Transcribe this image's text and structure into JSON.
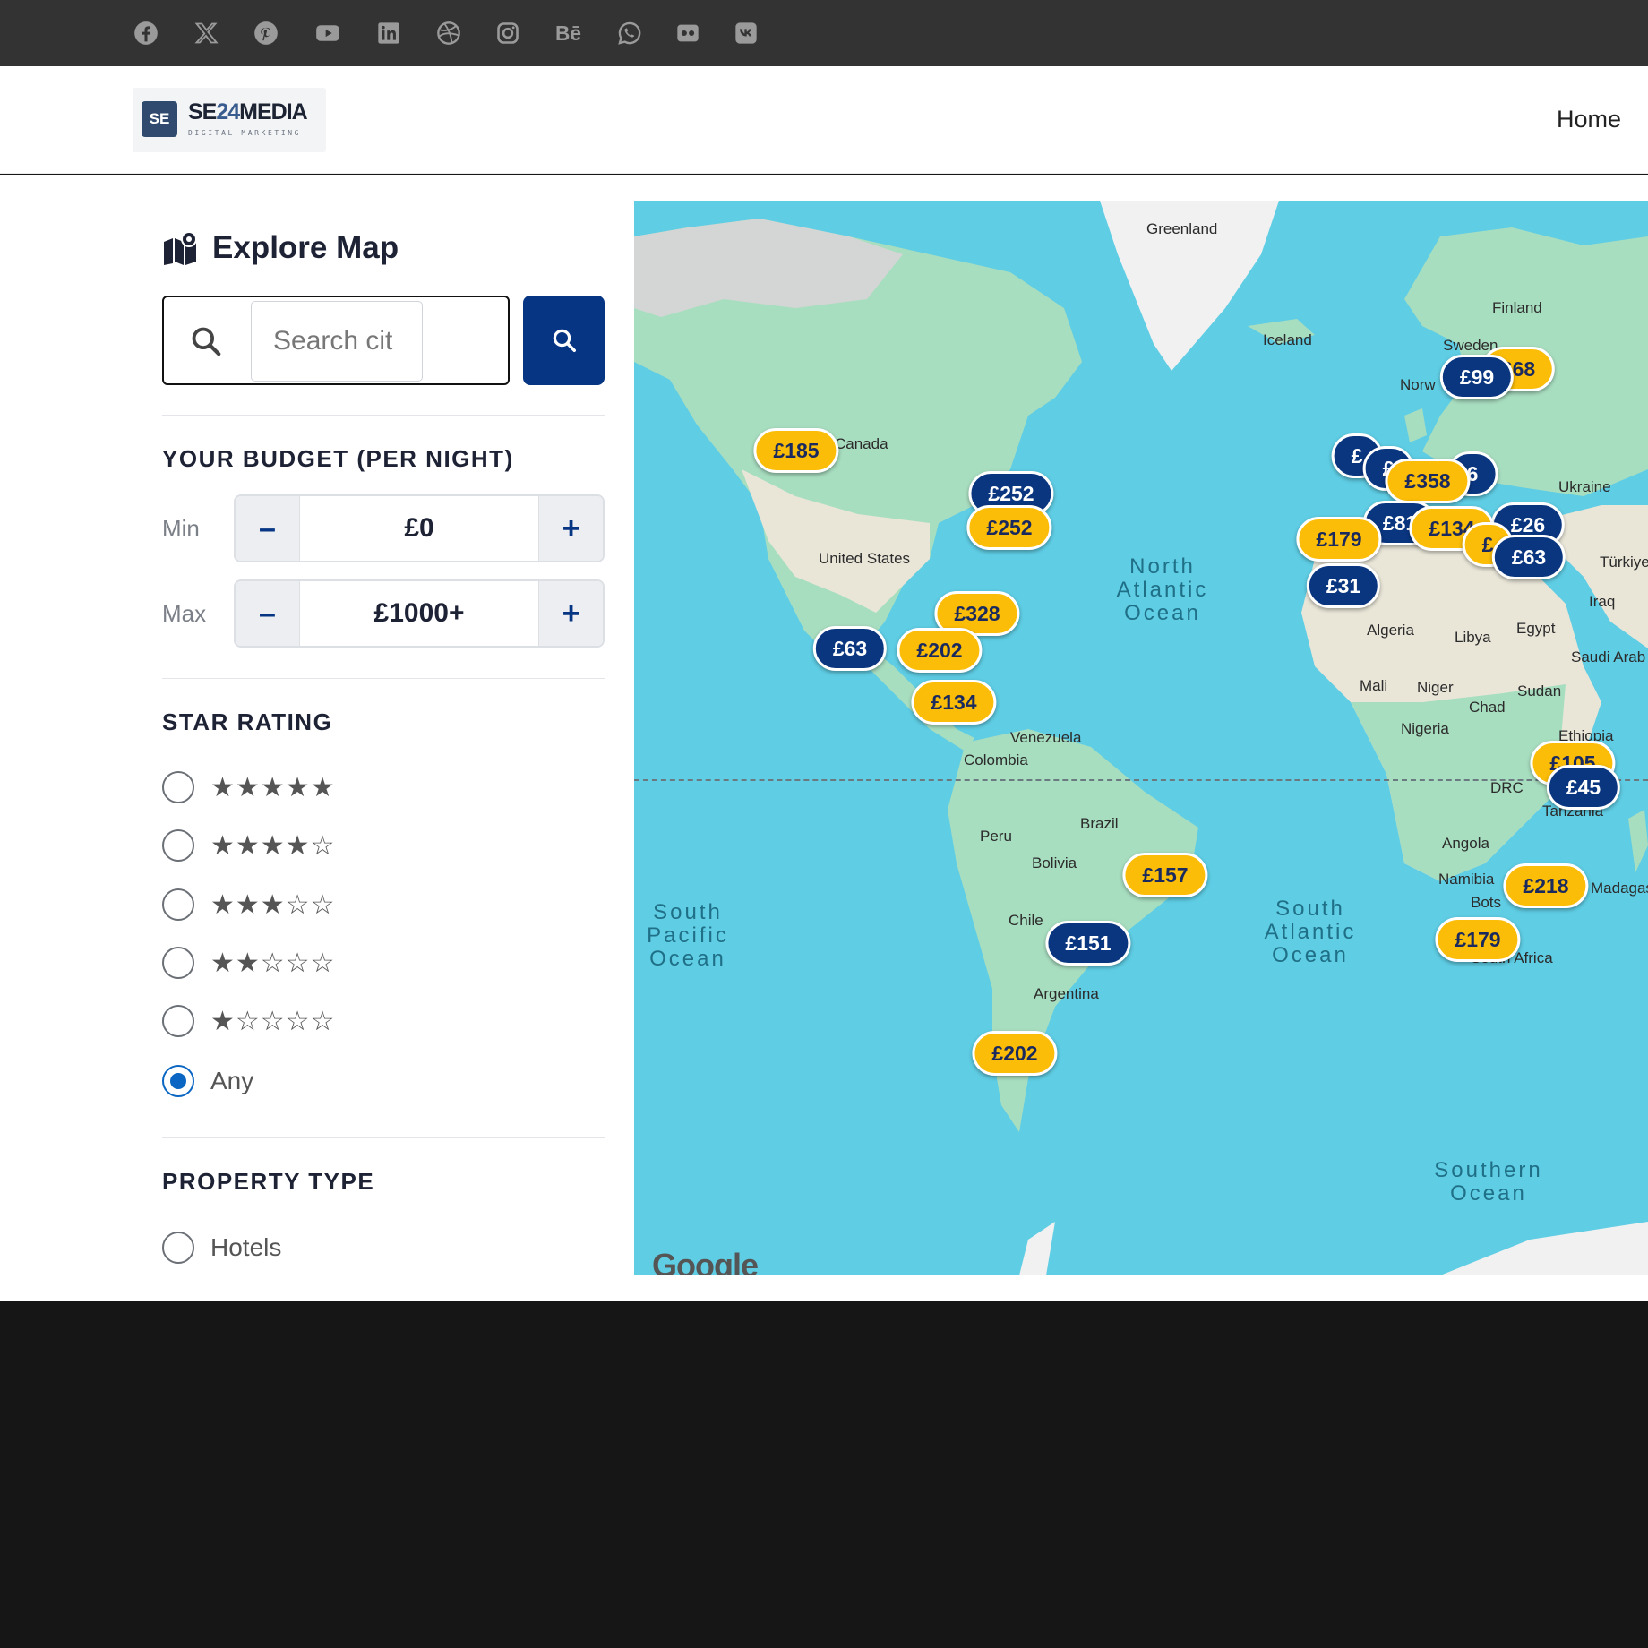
{
  "social": {
    "icons": [
      "facebook-icon",
      "x-icon",
      "pinterest-icon",
      "youtube-icon",
      "linkedin-icon",
      "dribbble-icon",
      "instagram-icon",
      "behance-icon",
      "whatsapp-icon",
      "flickr-icon",
      "vk-icon"
    ]
  },
  "header": {
    "logo_badge": "SE",
    "logo_name_a": "SE",
    "logo_name_b": "24",
    "logo_name_c": "MEDIA",
    "logo_sub": "DIGITAL MARKETING",
    "nav_home": "Home"
  },
  "sidebar": {
    "title": "Explore Map",
    "search_placeholder": "Search cit",
    "budget_title": "YOUR BUDGET (PER NIGHT)",
    "min_label": "Min",
    "min_value": "£0",
    "max_label": "Max",
    "max_value": "£1000+",
    "minus": "–",
    "plus": "+",
    "star_title": "STAR RATING",
    "star_options": [
      {
        "stars": "★★★★★",
        "checked": false
      },
      {
        "stars": "★★★★☆",
        "checked": false
      },
      {
        "stars": "★★★☆☆",
        "checked": false
      },
      {
        "stars": "★★☆☆☆",
        "checked": false
      },
      {
        "stars": "★☆☆☆☆",
        "checked": false
      }
    ],
    "star_any": "Any",
    "property_title": "PROPERTY TYPE",
    "property_option": "Hotels"
  },
  "map": {
    "attribution": "Google",
    "labels": [
      "Greenland",
      "Finland",
      "Iceland",
      "Sweden",
      "Norw",
      "Canada",
      "Ukraine",
      "United States",
      "Algeria",
      "Libya",
      "Egypt",
      "Iraq",
      "Saudi Arab",
      "Mali",
      "Niger",
      "Chad",
      "Sudan",
      "Nigeria",
      "Ethiopia",
      "Venezuela",
      "Colombia",
      "DRC",
      "Tanzania",
      "Brazil",
      "Peru",
      "Bolivia",
      "Angola",
      "Namibia",
      "Bots",
      "Madagas",
      "Chile",
      "Argentina",
      "South Africa",
      "Türkiye"
    ],
    "oceans": [
      "North Atlantic Ocean",
      "South Pacific Ocean",
      "South Atlantic Ocean",
      "Southern Ocean"
    ],
    "pins": [
      {
        "price": "£185",
        "style": "yellow"
      },
      {
        "price": "£252",
        "style": "blue"
      },
      {
        "price": "£252",
        "style": "yellow"
      },
      {
        "price": "£328",
        "style": "yellow"
      },
      {
        "price": "£63",
        "style": "blue"
      },
      {
        "price": "£202",
        "style": "yellow"
      },
      {
        "price": "£134",
        "style": "yellow"
      },
      {
        "price": "£157",
        "style": "yellow"
      },
      {
        "price": "£151",
        "style": "blue"
      },
      {
        "price": "£202",
        "style": "yellow"
      },
      {
        "price": "£68",
        "style": "yellow"
      },
      {
        "price": "£99",
        "style": "blue"
      },
      {
        "price": "£",
        "style": "blue"
      },
      {
        "price": "£",
        "style": "blue"
      },
      {
        "price": "£358",
        "style": "yellow"
      },
      {
        "price": "6",
        "style": "blue"
      },
      {
        "price": "£179",
        "style": "yellow"
      },
      {
        "price": "£81",
        "style": "blue"
      },
      {
        "price": "£134",
        "style": "yellow"
      },
      {
        "price": "£26",
        "style": "blue"
      },
      {
        "price": "£",
        "style": "yellow"
      },
      {
        "price": "£63",
        "style": "blue"
      },
      {
        "price": "£31",
        "style": "blue"
      },
      {
        "price": "£105",
        "style": "yellow"
      },
      {
        "price": "£45",
        "style": "blue"
      },
      {
        "price": "£218",
        "style": "yellow"
      },
      {
        "price": "£179",
        "style": "yellow"
      }
    ]
  },
  "colors": {
    "topbar": "#333333",
    "primary": "#063584",
    "pin_yellow": "#fbbd08",
    "pin_blue": "#0a3680",
    "ocean": "#5fcde4",
    "land": "#a8dec0",
    "radio_checked": "#0a66c2"
  }
}
